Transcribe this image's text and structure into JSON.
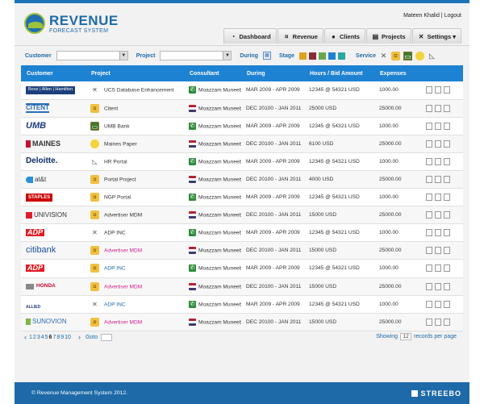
{
  "header": {
    "logo_title": "REVENUE",
    "logo_subtitle": "FORECAST SYSTEM",
    "user": "Mateen Khalid",
    "separator": " | ",
    "logout": "Logout",
    "nav": [
      {
        "label": "Dashboard",
        "icon": "dashboard-icon"
      },
      {
        "label": "Revenue",
        "icon": "coins-icon"
      },
      {
        "label": "Clients",
        "icon": "user-icon"
      },
      {
        "label": "Projects",
        "icon": "document-icon"
      },
      {
        "label": "Settings ▾",
        "icon": "tools-icon"
      }
    ]
  },
  "filters": {
    "customer_label": "Customer",
    "project_label": "Project",
    "during_label": "During",
    "stage_label": "Stage",
    "service_label": "Service",
    "stage_colors": [
      "#e2a21b",
      "#8b2b3a",
      "#6aa84f",
      "#1e82d2",
      "#2aa7a0"
    ]
  },
  "table": {
    "columns": [
      "Customer",
      "Project",
      "Consultant",
      "During",
      "Hours / Bid Amount",
      "Expenses"
    ],
    "rows": [
      {
        "customer": "Booz | Allen | Hamilton",
        "project": "UCS Database Enhancement",
        "pstyle": "",
        "picon": "tools",
        "consultant": "Moazzam Muneeb",
        "cflag": "green",
        "during": "MAR 2009 - APR 2009",
        "hours": "12345 @ 54321 USD",
        "expenses": "1000.00"
      },
      {
        "customer": "CITENT",
        "project": "Citent",
        "pstyle": "",
        "picon": "coins",
        "consultant": "Moazzam Muneeb",
        "cflag": "flag",
        "during": "DEC 20100 - JAN 2011",
        "hours": "25000 USD",
        "expenses": "25000.00"
      },
      {
        "customer": "UMB",
        "project": "UMB Bank",
        "pstyle": "",
        "picon": "board",
        "consultant": "Moazzam Muneeb",
        "cflag": "green",
        "during": "MAR 2009 - APR 2009",
        "hours": "12345 @ 54321 USD",
        "expenses": "1000.00"
      },
      {
        "customer": "MAINES",
        "project": "Maines Paper",
        "pstyle": "",
        "picon": "ball",
        "consultant": "Moazzam Muneeb",
        "cflag": "flag",
        "during": "DEC 20100 - JAN 2011",
        "hours": "6100 USD",
        "expenses": "25000.00"
      },
      {
        "customer": "Deloitte.",
        "project": "HR Portal",
        "pstyle": "",
        "picon": "ruler",
        "consultant": "Moazzam Muneeb",
        "cflag": "green",
        "during": "MAR 2009 - APR 2009",
        "hours": "12345 @ 54321 USD",
        "expenses": "1000.00"
      },
      {
        "customer": "at&t",
        "project": "Portal Project",
        "pstyle": "",
        "picon": "coins",
        "consultant": "Moazzam Muneeb",
        "cflag": "flag",
        "during": "DEC 20100 - JAN 2011",
        "hours": "4000 USD",
        "expenses": "25000.00"
      },
      {
        "customer": "STAPLES",
        "project": "NGP Portal",
        "pstyle": "",
        "picon": "coins",
        "consultant": "Moazzam Muneeb",
        "cflag": "green",
        "during": "MAR 2009 - APR 2009",
        "hours": "12345 @ 54321 USD",
        "expenses": "1000.00"
      },
      {
        "customer": "UNIVISION",
        "project": "Advertiser MDM",
        "pstyle": "",
        "picon": "coins",
        "consultant": "Moazzam Muneeb",
        "cflag": "flag",
        "during": "DEC 20100 - JAN 2011",
        "hours": "15000 USD",
        "expenses": "25000.00"
      },
      {
        "customer": "ADP",
        "project": "ADP INC",
        "pstyle": "",
        "picon": "tools",
        "consultant": "Moazzam Muneeb",
        "cflag": "green",
        "during": "MAR 2009 - APR 2009",
        "hours": "12345 @ 54321 USD",
        "expenses": "1000.00"
      },
      {
        "customer": "citibank",
        "project": "Advertiser MDM",
        "pstyle": "pink",
        "picon": "coins",
        "consultant": "Moazzam Muneeb",
        "cflag": "flag",
        "during": "DEC 20100 - JAN 2011",
        "hours": "15000 USD",
        "expenses": "25000.00"
      },
      {
        "customer": "ADP",
        "project": "ADP INC",
        "pstyle": "blue",
        "picon": "coins",
        "consultant": "Moazzam Muneeb",
        "cflag": "green",
        "during": "MAR 2009 - APR 2009",
        "hours": "12345 @ 54321 USD",
        "expenses": "1000.00"
      },
      {
        "customer": "HONDA",
        "project": "Advertiser MDM",
        "pstyle": "pink",
        "picon": "coins",
        "consultant": "Moazzam Muneeb",
        "cflag": "flag",
        "during": "DEC 20100 - JAN 2011",
        "hours": "15000 USD",
        "expenses": "25000.00"
      },
      {
        "customer": "ALLIED",
        "project": "ADP INC",
        "pstyle": "blue",
        "picon": "tools",
        "consultant": "Moazzam Muneeb",
        "cflag": "green",
        "during": "MAR 2009 - APR 2009",
        "hours": "12345 @ 54321 USD",
        "expenses": "1000.00"
      },
      {
        "customer": "SUNOVION",
        "project": "Advertiser MDM",
        "pstyle": "pink",
        "picon": "coins",
        "consultant": "Moazzam Muneeb",
        "cflag": "flag",
        "during": "DEC 20100 - JAN 2011",
        "hours": "15000 USD",
        "expenses": "25000.00"
      }
    ]
  },
  "pager": {
    "prev": "‹",
    "pages": [
      "1",
      "2",
      "3",
      "4",
      "5",
      "6",
      "7",
      "8",
      "9",
      "10"
    ],
    "current": "6",
    "next": "›",
    "goto_label": "Goto",
    "showing_label": "Showing",
    "per_page": "12",
    "per_page_suffix": "records per page"
  },
  "footer": {
    "copyright": "© Revenue Management System 2012.",
    "brand": "STREEBO"
  }
}
